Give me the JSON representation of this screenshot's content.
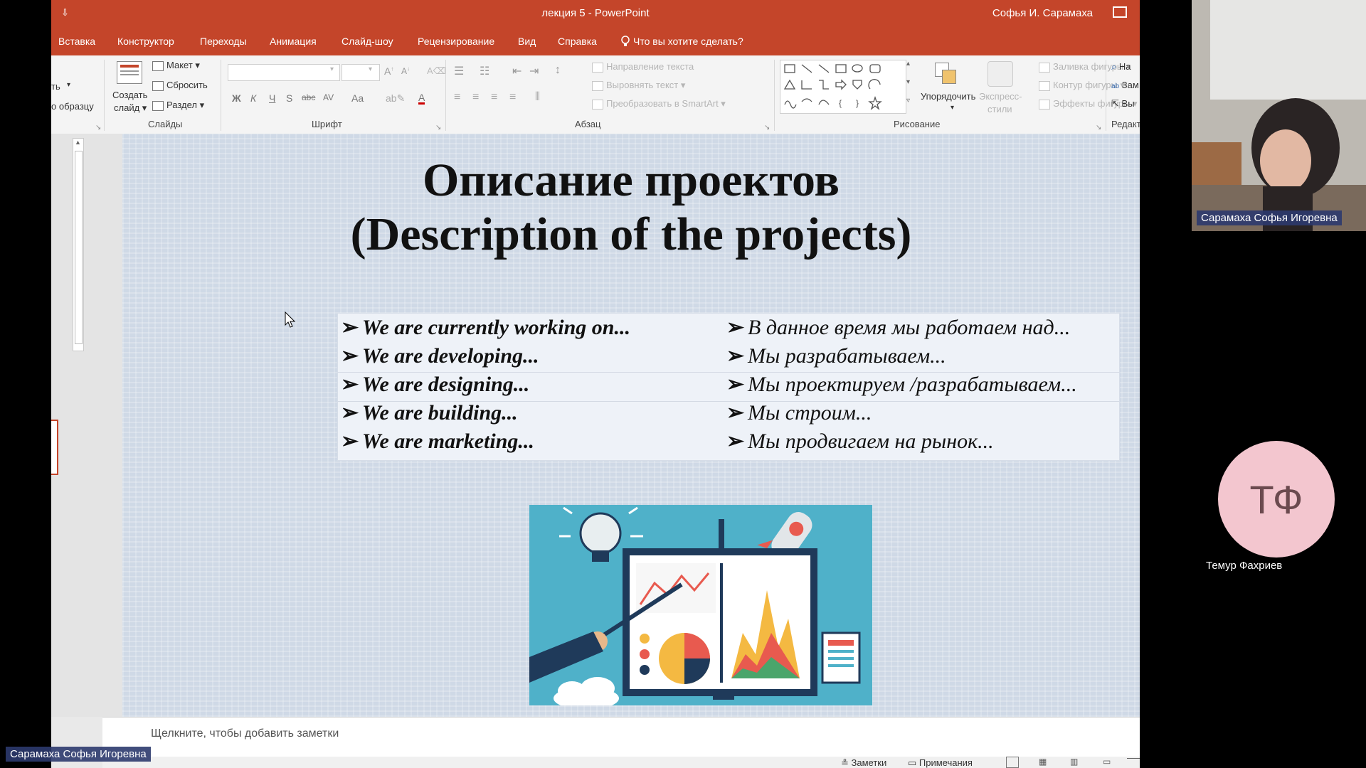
{
  "window": {
    "quick_access": "⇩",
    "title": "лекция 5  -  PowerPoint",
    "user": "Софья И. Сарамаха"
  },
  "tabs": [
    "Вставка",
    "Конструктор",
    "Переходы",
    "Анимация",
    "Слайд-шоу",
    "Рецензирование",
    "Вид",
    "Справка"
  ],
  "tell_me": "Что вы хотите сделать?",
  "ribbon": {
    "clipboard": {
      "paste_part": "ть",
      "format_painter": "о образцу"
    },
    "slides": {
      "new_slide_1": "Создать",
      "new_slide_2": "слайд",
      "layout": "Макет",
      "reset": "Сбросить",
      "section": "Раздел",
      "group_label": "Слайды"
    },
    "font": {
      "group_label": "Шрифт",
      "bold": "Ж",
      "italic": "К",
      "underline": "Ч",
      "shadow": "S",
      "strike": "abc",
      "spacing": "AV",
      "case": "Aa",
      "color": "A"
    },
    "paragraph": {
      "text_direction": "Направление текста",
      "align_text": "Выровнять текст",
      "convert_smartart": "Преобразовать в SmartArt",
      "group_label": "Абзац"
    },
    "drawing": {
      "arrange": "Упорядочить",
      "quick_styles_1": "Экспресс-",
      "quick_styles_2": "стили",
      "shape_fill": "Заливка фигуры",
      "shape_outline": "Контур фигуры",
      "shape_effects": "Эффекты фигуры",
      "group_label": "Рисование"
    },
    "editing": {
      "find": "На",
      "replace": "Зам",
      "select": "Вы",
      "group_label": "Редакт"
    }
  },
  "slide": {
    "title_line1": "Описание проектов",
    "title_line2": "(Description of the projects)",
    "phrases_en": [
      "We are currently working on...",
      "We are developing...",
      "We are designing...",
      "We are building...",
      "We are marketing..."
    ],
    "phrases_ru": [
      "В данное время мы работаем над...",
      "Мы разрабатываем...",
      "Мы проектируем /разрабатываем...",
      "Мы строим...",
      "Мы продвигаем на рынок..."
    ],
    "bullet_glyph": "➢"
  },
  "notes_placeholder": "Щелкните, чтобы добавить заметки",
  "status": {
    "notes": "Заметки",
    "comments": "Примечания"
  },
  "participants": {
    "speaker_name": "Сарамаха Софья Игоревна",
    "other_initials": "ТФ",
    "other_name": "Темур Фахриев"
  },
  "colors": {
    "ribbon_accent": "#c4452a",
    "avatar_bg": "#f3c6cf",
    "name_tag_bg": "#2c3a6e"
  }
}
